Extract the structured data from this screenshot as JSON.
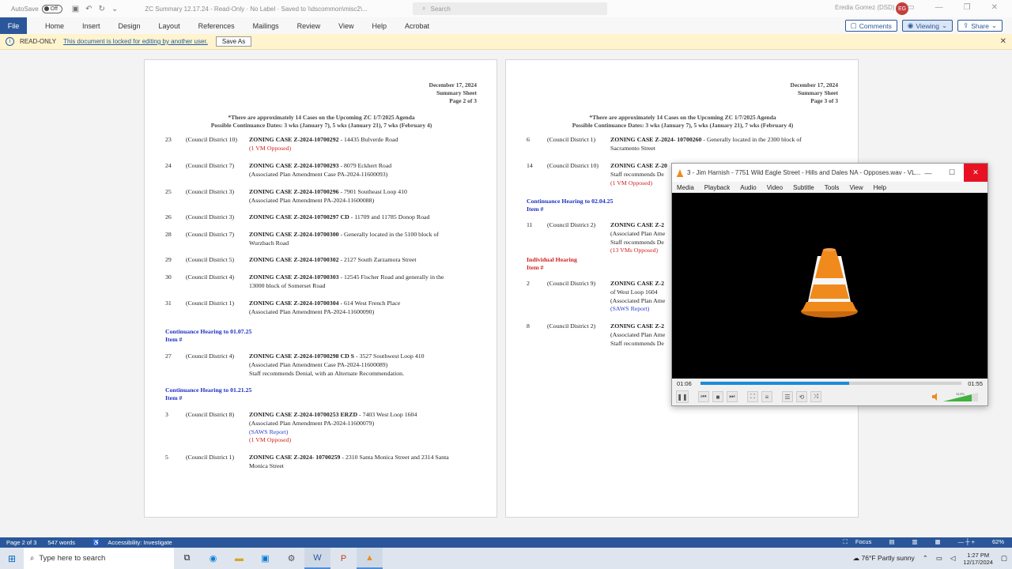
{
  "titlebar": {
    "autosave_label": "AutoSave",
    "autosave_state": "Off",
    "doc_title": "ZC Summary 12.17.24  -  Read-Only  ·  No Label  ·  Saved to \\\\dscommon\\misc2\\...",
    "search_placeholder": "Search",
    "user_name": "Eredia Gomez (DSD)",
    "user_initials": "EG"
  },
  "ribbon": {
    "file": "File",
    "tabs": [
      "Home",
      "Insert",
      "Design",
      "Layout",
      "References",
      "Mailings",
      "Review",
      "View",
      "Help",
      "Acrobat"
    ],
    "comments": "Comments",
    "viewing": "Viewing",
    "share": "Share"
  },
  "infobar": {
    "label": "READ-ONLY",
    "message": "This document is locked for editing by another user.",
    "save_as": "Save As"
  },
  "page2": {
    "date": "December 17, 2024",
    "sheet": "Summary Sheet",
    "page": "Page 2 of 3",
    "note1": "*There are approximately 14 Cases on the Upcoming ZC 1/7/2025 Agenda",
    "note2": "Possible Continuance Dates: 3 wks (January 7), 5 wks (January 21), 7 wks (February 4)",
    "rows": [
      {
        "num": "23",
        "dist": "(Council District 10)",
        "case": "ZONING CASE Z-2024-10700292",
        "desc": " - 14435 Bulverde Road",
        "l2": "(1 VM Opposed)",
        "l2c": "red"
      },
      {
        "num": "24",
        "dist": "(Council District 7)",
        "case": "ZONING CASE Z-2024-10700293",
        "desc": " - 8079 Eckhert Road",
        "l2": "(Associated Plan Amendment Case PA-2024-11600093)",
        "l2c": ""
      },
      {
        "num": "25",
        "dist": "(Council District 3)",
        "case": "ZONING CASE Z-2024-10700296",
        "desc": " - 7901 Southeast Loop 410",
        "l2": "(Associated Plan Amendment PA-2024-11600088)",
        "l2c": ""
      },
      {
        "num": "26",
        "dist": "(Council District 3)",
        "case": "ZONING CASE Z-2024-10700297 CD",
        "desc": " - 11709 and 11785 Donop Road",
        "l2": "",
        "l2c": ""
      },
      {
        "num": "28",
        "dist": "(Council District 7)",
        "case": "ZONING CASE Z-2024-10700300",
        "desc": " - Generally located in the 5100 block of",
        "l2": "Wurzbach Road",
        "l2c": ""
      },
      {
        "num": "29",
        "dist": "(Council District 5)",
        "case": "ZONING CASE Z-2024-10700302",
        "desc": " - 2127 South Zarzamora Street",
        "l2": "",
        "l2c": ""
      },
      {
        "num": "30",
        "dist": "(Council District 4)",
        "case": "ZONING CASE Z-2024-10700303",
        "desc": " - 12545 Fischer Road and generally in the",
        "l2": "13000 block of Somerset Road",
        "l2c": ""
      },
      {
        "num": "31",
        "dist": "(Council District 1)",
        "case": "ZONING CASE Z-2024-10700304",
        "desc": " - 614 West French Place",
        "l2": "(Associated Plan Amendment PA-2024-11600090)",
        "l2c": ""
      }
    ],
    "sect1": "Continuance Hearing to 01.07.25",
    "sect1_item": "Item #",
    "row27": {
      "num": "27",
      "dist": "(Council District 4)",
      "case": "ZONING CASE Z-2024-10700298 CD S",
      "desc": " - 3527 Southwest Loop 410",
      "l2": "(Associated Plan Amendment Case PA-2024-11600089)",
      "l3": "Staff recommends Denial, with an Alternate Recommendation."
    },
    "sect2": "Continuance Hearing to 01.21.25",
    "sect2_item": "Item #",
    "row3": {
      "num": "3",
      "dist": "(Council District 8)",
      "case": "ZONING CASE Z-2024-10700253 ERZD",
      "desc": " - 7403 West Loop 1604",
      "l2": "(Associated Plan Amendment PA-2024-11600079)",
      "l3": "(SAWS Report)",
      "l4": "(1 VM Opposed)"
    },
    "row5": {
      "num": "5",
      "dist": "(Council District 1)",
      "case": "ZONING CASE Z-2024- 10700259",
      "desc": " - 2310 Santa Monica Street and 2314 Santa",
      "l2": "Monica Street"
    }
  },
  "page3": {
    "date": "December 17, 2024",
    "sheet": "Summary Sheet",
    "page": "Page 3 of 3",
    "note1": "*There are approximately 14 Cases on the Upcoming ZC 1/7/2025 Agenda",
    "note2": "Possible Continuance Dates: 3 wks (January 7), 5 wks (January 21), 7 wks (February 4)",
    "row6": {
      "num": "6",
      "dist": "(Council District 1)",
      "case": "ZONING CASE Z-2024- 10700260",
      "desc": " - Generally located in the 2300 block of",
      "l2": "Sacramento Street"
    },
    "row14": {
      "num": "14",
      "dist": "(Council District 10)",
      "case": "ZONING CASE Z-20",
      "l2": "Staff recommends De",
      "l3": "(1 VM Opposed)"
    },
    "sect1": "Continuance Hearing to 02.04.25",
    "sect1_item": "Item #",
    "row11": {
      "num": "11",
      "dist": "(Council District 2)",
      "case": "ZONING CASE Z-2",
      "l2": "(Associated Plan Ame",
      "l3": "Staff recommends De",
      "l4": "(13 VMs Opposed)"
    },
    "sect2": "Individual Hearing",
    "sect2_item": "Item #",
    "row2": {
      "num": "2",
      "dist": "(Council District 9)",
      "case": "ZONING CASE Z-2",
      "l2": "of West Loop 1604",
      "l3": "(Associated Plan Ame",
      "l4": "(SAWS Report)"
    },
    "row8": {
      "num": "8",
      "dist": "(Council District 2)",
      "case": "ZONING CASE Z-2",
      "l2": "(Associated Plan Ame",
      "l3": "Staff recommends De"
    }
  },
  "vlc": {
    "title": "3 - Jim Harnish - 7751 Wild Eagle Street - Hills and Dales NA - Opposes.wav - VL...",
    "menu": [
      "Media",
      "Playback",
      "Audio",
      "Video",
      "Subtitle",
      "Tools",
      "View",
      "Help"
    ],
    "elapsed": "01:06",
    "total": "01:55",
    "progress": 0.57,
    "volume": "114%"
  },
  "statusbar": {
    "page": "Page 2 of 3",
    "words": "547 words",
    "accessibility": "Accessibility: Investigate",
    "focus": "Focus",
    "zoom": "62%"
  },
  "taskbar": {
    "search_placeholder": "Type here to search",
    "weather": "76°F  Partly sunny",
    "time": "1:27 PM",
    "date": "12/17/2024"
  },
  "colors": {
    "word_blue": "#2b579a",
    "readonly_bg": "#fff4ce",
    "vlc_close": "#e81123",
    "vlc_orange": "#f08a1c"
  }
}
